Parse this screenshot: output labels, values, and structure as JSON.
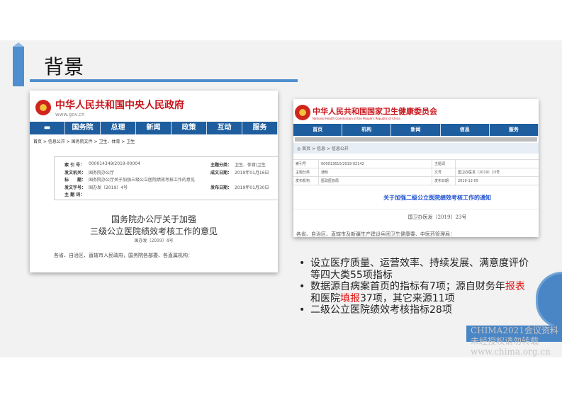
{
  "slide": {
    "title": "背景"
  },
  "left_doc": {
    "site_name": "中华人民共和国中央人民政府",
    "site_url": "www.gov.cn",
    "nav": [
      "国务院",
      "总理",
      "新闻",
      "政策",
      "互动",
      "服务"
    ],
    "breadcrumb": "首页 > 信息公开 > 国务院文件 > 卫生、体育 > 卫生",
    "meta": [
      {
        "label": "索 引 号：",
        "value": "000014349/2019-00004",
        "label2": "主题分类：",
        "value2": "卫生、体育\\卫生"
      },
      {
        "label": "发文机关：",
        "value": "国务院办公厅",
        "label2": "成文日期：",
        "value2": "2019年01月16日"
      },
      {
        "label": "标　　题：",
        "value": "国务院办公厅关于加强三级公立医院绩效考核工作的意见",
        "label2": "",
        "value2": ""
      },
      {
        "label": "发文字号：",
        "value": "国办发〔2019〕4号",
        "label2": "发布日期：",
        "value2": "2019年01月30日"
      },
      {
        "label": "主 题 词：",
        "value": "",
        "label2": "",
        "value2": ""
      }
    ],
    "doc_title_1": "国务院办公厅关于加强",
    "doc_title_2": "三级公立医院绩效考核工作的意见",
    "doc_number": "国办发〔2019〕4号",
    "salutation": "各省、自治区、直辖市人民政府，国务院各部委、各直属机构："
  },
  "right_doc": {
    "site_name": "中华人民共和国国家卫生健康委员会",
    "site_name_en": "National Health Commission of the People's Republic of China",
    "nav": [
      "首页",
      "机构",
      "新闻",
      "信息",
      "服务"
    ],
    "breadcrumb": "首页 > 信息 > 信息公开",
    "meta": [
      {
        "label": "索引号",
        "value": "000013610/2019-02142",
        "label2": "主题词",
        "value2": ""
      },
      {
        "label": "主题分类",
        "value": "通知",
        "label2": "文号",
        "value2": "国卫办医发〔2019〕23号"
      },
      {
        "label": "发布机构",
        "value": "医政医管局",
        "label2": "发布日期",
        "value2": "2019-12-05"
      }
    ],
    "doc_title": "关于加强二级公立医院绩效考核工作的通知",
    "doc_number": "国卫办医发〔2019〕23号",
    "salutation": "各省、自治区、直辖市及新疆生产建设兵团卫生健康委、中医药管理局："
  },
  "bullets": [
    {
      "parts": [
        {
          "t": "设立医疗质量、运营效率、持续发展、满意度评价等四大类55项指标"
        }
      ]
    },
    {
      "parts": [
        {
          "t": "数据源自病案首页的指标有7项；源自财务年"
        },
        {
          "t": "报表",
          "hl": true
        },
        {
          "t": "和医院"
        },
        {
          "t": "填报",
          "hl": true
        },
        {
          "t": "37项，其它来源11项"
        }
      ]
    },
    {
      "parts": [
        {
          "t": "二级公立医院绩效考核指标28项"
        }
      ]
    }
  ],
  "watermark": [
    "CHIMA2021会议资料",
    "未经授权请勿转载",
    "www.chima.org.cn"
  ],
  "colors": {
    "accent": "#4f8fcf",
    "nav": "#1e5e9f",
    "highlight": "#e01010",
    "site_red": "#c8161d"
  }
}
